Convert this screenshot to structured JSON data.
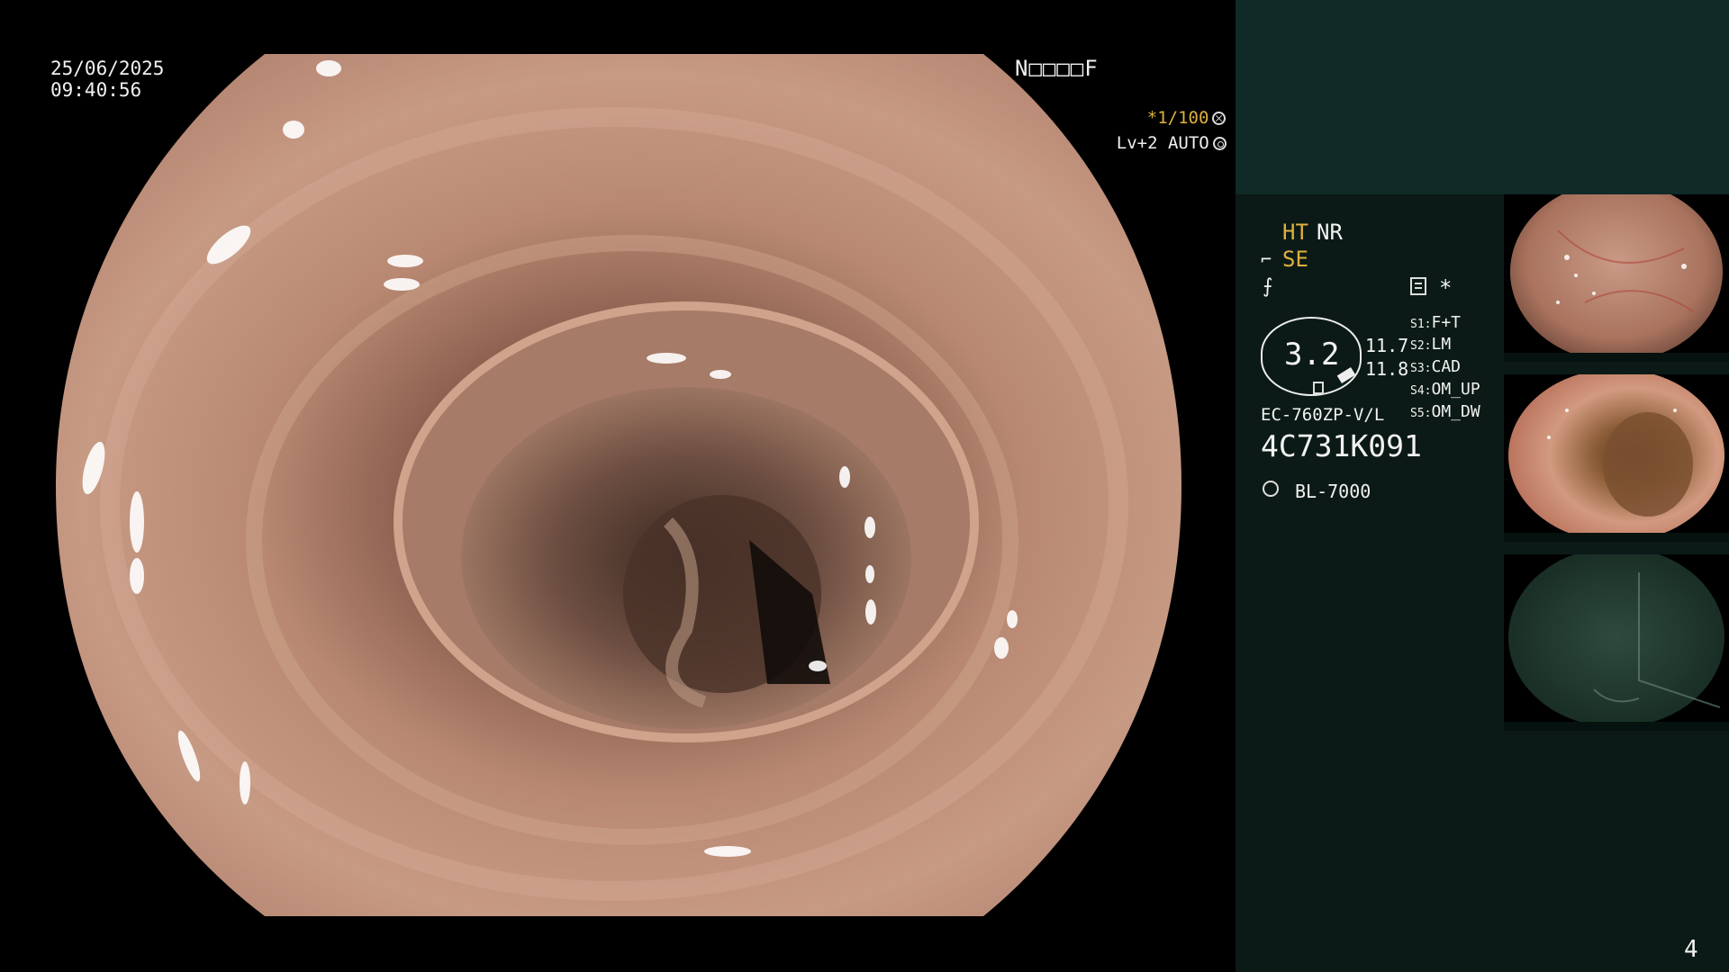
{
  "overlay": {
    "date": "25/06/2025",
    "time": "09:40:56",
    "code": "N□□□□F",
    "shutter": "*1/100",
    "level": "Lv+2 AUTO"
  },
  "panel": {
    "ht": "HT",
    "nr": "NR",
    "se": "SE",
    "star": "*",
    "gauge_value": "3.2",
    "gauge_upper": "11.7",
    "gauge_lower": "11.8",
    "switches": [
      {
        "key": "S1",
        "value": "F+T"
      },
      {
        "key": "S2",
        "value": "LM"
      },
      {
        "key": "S3",
        "value": "CAD"
      },
      {
        "key": "S4",
        "value": "OM_UP"
      },
      {
        "key": "S5",
        "value": "OM_DW"
      }
    ],
    "scope_model": "EC-760ZP-V/L",
    "serial": "4C731K091",
    "light_source": "BL-7000"
  },
  "page_number": "4",
  "colors": {
    "panel_bg": "#0b1a16",
    "panel_top_bg": "#0f2a27",
    "accent_yellow": "#e0b040"
  }
}
